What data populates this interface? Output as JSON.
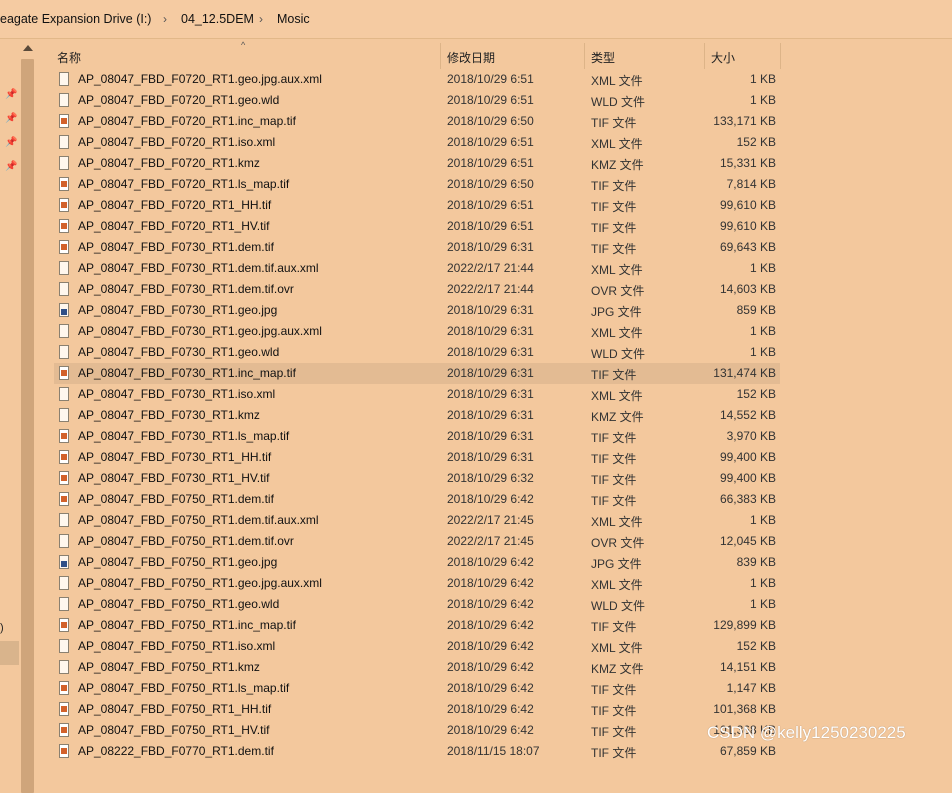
{
  "breadcrumb": {
    "drive": "eagate Expansion Drive (I:)",
    "folder1": "04_12.5DEM",
    "folder2": "Mosic"
  },
  "columns": {
    "name": "名称",
    "date": "修改日期",
    "type": "类型",
    "size": "大小"
  },
  "nav": {
    "partial_label": ")"
  },
  "watermark": "CSDN @kelly1250230225",
  "files": [
    {
      "name": "AP_08047_FBD_F0720_RT1.geo.jpg.aux.xml",
      "date": "2018/10/29 6:51",
      "type": "XML 文件",
      "size": "1 KB",
      "icon": "doc"
    },
    {
      "name": "AP_08047_FBD_F0720_RT1.geo.wld",
      "date": "2018/10/29 6:51",
      "type": "WLD 文件",
      "size": "1 KB",
      "icon": "doc"
    },
    {
      "name": "AP_08047_FBD_F0720_RT1.inc_map.tif",
      "date": "2018/10/29 6:50",
      "type": "TIF 文件",
      "size": "133,171 KB",
      "icon": "tif"
    },
    {
      "name": "AP_08047_FBD_F0720_RT1.iso.xml",
      "date": "2018/10/29 6:51",
      "type": "XML 文件",
      "size": "152 KB",
      "icon": "doc"
    },
    {
      "name": "AP_08047_FBD_F0720_RT1.kmz",
      "date": "2018/10/29 6:51",
      "type": "KMZ 文件",
      "size": "15,331 KB",
      "icon": "doc"
    },
    {
      "name": "AP_08047_FBD_F0720_RT1.ls_map.tif",
      "date": "2018/10/29 6:50",
      "type": "TIF 文件",
      "size": "7,814 KB",
      "icon": "tif"
    },
    {
      "name": "AP_08047_FBD_F0720_RT1_HH.tif",
      "date": "2018/10/29 6:51",
      "type": "TIF 文件",
      "size": "99,610 KB",
      "icon": "tif"
    },
    {
      "name": "AP_08047_FBD_F0720_RT1_HV.tif",
      "date": "2018/10/29 6:51",
      "type": "TIF 文件",
      "size": "99,610 KB",
      "icon": "tif"
    },
    {
      "name": "AP_08047_FBD_F0730_RT1.dem.tif",
      "date": "2018/10/29 6:31",
      "type": "TIF 文件",
      "size": "69,643 KB",
      "icon": "tif"
    },
    {
      "name": "AP_08047_FBD_F0730_RT1.dem.tif.aux.xml",
      "date": "2022/2/17 21:44",
      "type": "XML 文件",
      "size": "1 KB",
      "icon": "doc"
    },
    {
      "name": "AP_08047_FBD_F0730_RT1.dem.tif.ovr",
      "date": "2022/2/17 21:44",
      "type": "OVR 文件",
      "size": "14,603 KB",
      "icon": "doc"
    },
    {
      "name": "AP_08047_FBD_F0730_RT1.geo.jpg",
      "date": "2018/10/29 6:31",
      "type": "JPG 文件",
      "size": "859 KB",
      "icon": "jpg"
    },
    {
      "name": "AP_08047_FBD_F0730_RT1.geo.jpg.aux.xml",
      "date": "2018/10/29 6:31",
      "type": "XML 文件",
      "size": "1 KB",
      "icon": "doc"
    },
    {
      "name": "AP_08047_FBD_F0730_RT1.geo.wld",
      "date": "2018/10/29 6:31",
      "type": "WLD 文件",
      "size": "1 KB",
      "icon": "doc"
    },
    {
      "name": "AP_08047_FBD_F0730_RT1.inc_map.tif",
      "date": "2018/10/29 6:31",
      "type": "TIF 文件",
      "size": "131,474 KB",
      "icon": "tif",
      "selected": true
    },
    {
      "name": "AP_08047_FBD_F0730_RT1.iso.xml",
      "date": "2018/10/29 6:31",
      "type": "XML 文件",
      "size": "152 KB",
      "icon": "doc"
    },
    {
      "name": "AP_08047_FBD_F0730_RT1.kmz",
      "date": "2018/10/29 6:31",
      "type": "KMZ 文件",
      "size": "14,552 KB",
      "icon": "doc"
    },
    {
      "name": "AP_08047_FBD_F0730_RT1.ls_map.tif",
      "date": "2018/10/29 6:31",
      "type": "TIF 文件",
      "size": "3,970 KB",
      "icon": "tif"
    },
    {
      "name": "AP_08047_FBD_F0730_RT1_HH.tif",
      "date": "2018/10/29 6:31",
      "type": "TIF 文件",
      "size": "99,400 KB",
      "icon": "tif"
    },
    {
      "name": "AP_08047_FBD_F0730_RT1_HV.tif",
      "date": "2018/10/29 6:32",
      "type": "TIF 文件",
      "size": "99,400 KB",
      "icon": "tif"
    },
    {
      "name": "AP_08047_FBD_F0750_RT1.dem.tif",
      "date": "2018/10/29 6:42",
      "type": "TIF 文件",
      "size": "66,383 KB",
      "icon": "tif"
    },
    {
      "name": "AP_08047_FBD_F0750_RT1.dem.tif.aux.xml",
      "date": "2022/2/17 21:45",
      "type": "XML 文件",
      "size": "1 KB",
      "icon": "doc"
    },
    {
      "name": "AP_08047_FBD_F0750_RT1.dem.tif.ovr",
      "date": "2022/2/17 21:45",
      "type": "OVR 文件",
      "size": "12,045 KB",
      "icon": "doc"
    },
    {
      "name": "AP_08047_FBD_F0750_RT1.geo.jpg",
      "date": "2018/10/29 6:42",
      "type": "JPG 文件",
      "size": "839 KB",
      "icon": "jpg"
    },
    {
      "name": "AP_08047_FBD_F0750_RT1.geo.jpg.aux.xml",
      "date": "2018/10/29 6:42",
      "type": "XML 文件",
      "size": "1 KB",
      "icon": "doc"
    },
    {
      "name": "AP_08047_FBD_F0750_RT1.geo.wld",
      "date": "2018/10/29 6:42",
      "type": "WLD 文件",
      "size": "1 KB",
      "icon": "doc"
    },
    {
      "name": "AP_08047_FBD_F0750_RT1.inc_map.tif",
      "date": "2018/10/29 6:42",
      "type": "TIF 文件",
      "size": "129,899 KB",
      "icon": "tif"
    },
    {
      "name": "AP_08047_FBD_F0750_RT1.iso.xml",
      "date": "2018/10/29 6:42",
      "type": "XML 文件",
      "size": "152 KB",
      "icon": "doc"
    },
    {
      "name": "AP_08047_FBD_F0750_RT1.kmz",
      "date": "2018/10/29 6:42",
      "type": "KMZ 文件",
      "size": "14,151 KB",
      "icon": "doc"
    },
    {
      "name": "AP_08047_FBD_F0750_RT1.ls_map.tif",
      "date": "2018/10/29 6:42",
      "type": "TIF 文件",
      "size": "1,147 KB",
      "icon": "tif"
    },
    {
      "name": "AP_08047_FBD_F0750_RT1_HH.tif",
      "date": "2018/10/29 6:42",
      "type": "TIF 文件",
      "size": "101,368 KB",
      "icon": "tif"
    },
    {
      "name": "AP_08047_FBD_F0750_RT1_HV.tif",
      "date": "2018/10/29 6:42",
      "type": "TIF 文件",
      "size": "101,368 KB",
      "icon": "tif"
    },
    {
      "name": "AP_08222_FBD_F0770_RT1.dem.tif",
      "date": "2018/11/15 18:07",
      "type": "TIF 文件",
      "size": "67,859 KB",
      "icon": "tif"
    }
  ]
}
